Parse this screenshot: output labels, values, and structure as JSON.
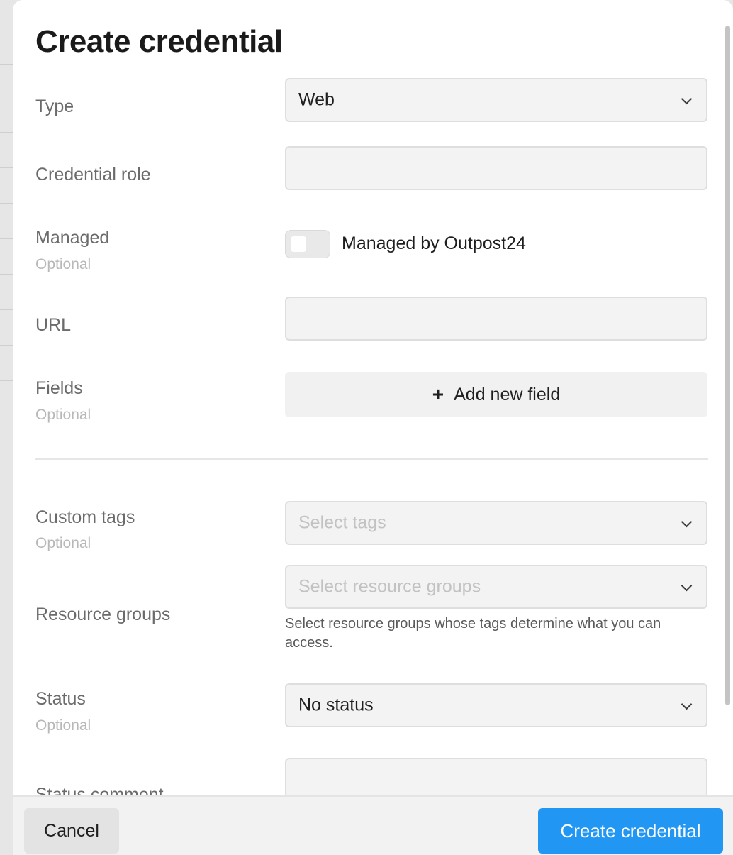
{
  "dialog": {
    "title": "Create credential"
  },
  "form": {
    "type": {
      "label": "Type",
      "value": "Web"
    },
    "credential_role": {
      "label": "Credential role",
      "value": ""
    },
    "managed": {
      "label": "Managed",
      "optional": "Optional",
      "toggle_label": "Managed by Outpost24",
      "checked": false
    },
    "url": {
      "label": "URL",
      "value": ""
    },
    "fields": {
      "label": "Fields",
      "optional": "Optional",
      "add_button": "Add new field",
      "add_icon": "plus-icon"
    },
    "custom_tags": {
      "label": "Custom tags",
      "optional": "Optional",
      "placeholder": "Select tags"
    },
    "resource_groups": {
      "label": "Resource groups",
      "placeholder": "Select resource groups",
      "helper": "Select resource groups whose tags determine what you can access."
    },
    "status": {
      "label": "Status",
      "optional": "Optional",
      "value": "No status"
    },
    "status_comment": {
      "label": "Status comment",
      "value": ""
    }
  },
  "footer": {
    "cancel_label": "Cancel",
    "submit_label": "Create credential"
  },
  "colors": {
    "primary": "#2196f3",
    "field_bg": "#f3f3f3",
    "label_text": "#6b6b6b",
    "optional_text": "#b8b8b8"
  }
}
